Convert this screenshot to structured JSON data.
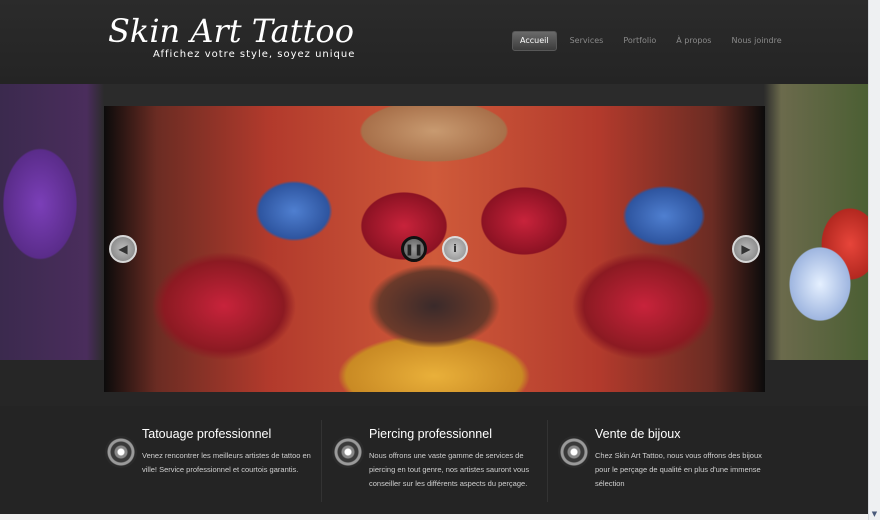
{
  "header": {
    "logo_title": "Skin Art Tattoo",
    "logo_tagline": "Affichez votre style, soyez unique"
  },
  "nav": {
    "items": [
      {
        "label": "Accueil",
        "active": true
      },
      {
        "label": "Services",
        "active": false
      },
      {
        "label": "Portfolio",
        "active": false
      },
      {
        "label": "À propos",
        "active": false
      },
      {
        "label": "Nous joindre",
        "active": false
      }
    ]
  },
  "slider": {
    "prev_icon": "arrow-left-icon",
    "next_icon": "arrow-right-icon",
    "pause_icon": "pause-icon",
    "info_icon": "info-icon",
    "prev_glyph": "◀",
    "next_glyph": "▶",
    "pause_glyph": "❚❚",
    "info_glyph": "i"
  },
  "features": [
    {
      "title": "Tatouage professionnel",
      "text": "Venez rencontrer les meilleurs artistes de tattoo en ville! Service professionnel et courtois garantis."
    },
    {
      "title": "Piercing professionnel",
      "text": "Nous offrons une vaste gamme de services de piercing en tout genre, nos artistes sauront vous conseiller sur les différents aspects du perçage."
    },
    {
      "title": "Vente de bijoux",
      "text": "Chez Skin Art Tattoo, nous vous offrons des bijoux pour le perçage de qualité en plus d'une immense sélection"
    }
  ],
  "colors": {
    "background": "#2a2a2a",
    "header": "#242424",
    "nav_active": "#4a4a4a",
    "text_light": "#ffffff",
    "text_muted": "#8a8a8a"
  }
}
